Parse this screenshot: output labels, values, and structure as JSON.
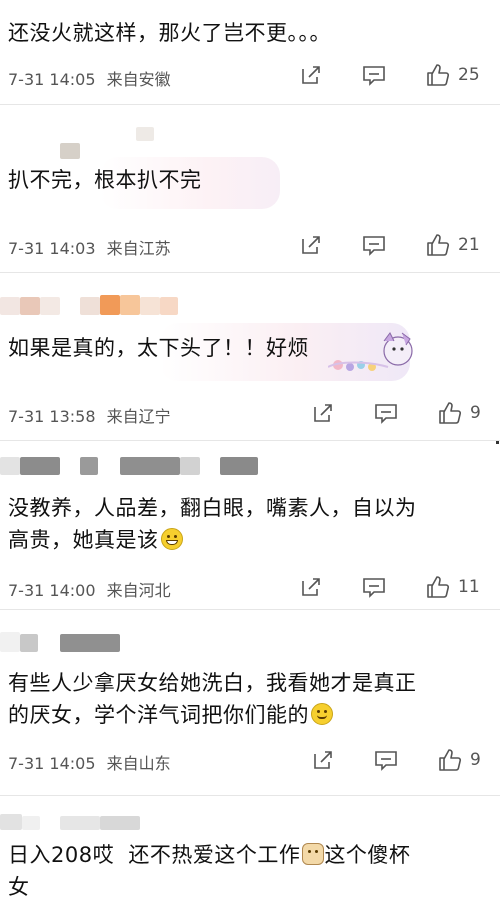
{
  "top_fragment": "",
  "comments": [
    {
      "text": "还没火就这样，那火了岂不更。。。",
      "date": "7-31 14:05",
      "location": "来自安徽",
      "likes": "25"
    },
    {
      "text": "扒不完，根本扒不完",
      "date": "7-31 14:03",
      "location": "来自江苏",
      "likes": "21"
    },
    {
      "text": "如果是真的，太下头了！！好烦",
      "date": "7-31 13:58",
      "location": "来自辽宁",
      "likes": "9"
    },
    {
      "text_line1": "没教养，人品差，翻白眼，嘴素人，自以为",
      "text_line2": "高贵，她真是该",
      "emoji": "grin-emoji",
      "date": "7-31 14:00",
      "location": "来自河北",
      "likes": "11"
    },
    {
      "text_line1": "有些人少拿厌女给她洗白，我看她才是真正",
      "text_line2": "的厌女，学个洋气词把你们能的",
      "emoji": "smile-emoji",
      "date": "7-31 14:05",
      "location": "来自山东",
      "likes": "9"
    },
    {
      "text_line1_a": "日入208哎  还不热爱这个工作",
      "text_line1_b": "这个傻杯",
      "text_line2": "女",
      "emoji": "cat-emoji"
    }
  ],
  "icons": {
    "share": "share-icon",
    "comment": "comment-icon",
    "like": "thumbs-up-icon"
  }
}
